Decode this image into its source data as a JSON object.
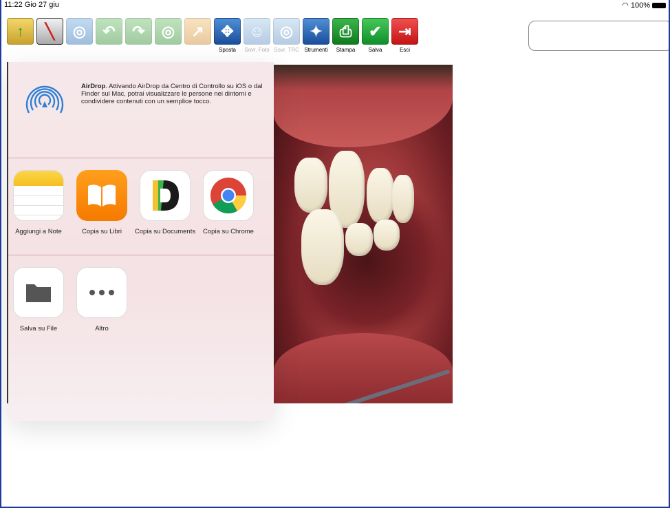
{
  "statusbar": {
    "time": "11:22  Gio 27 giu",
    "battery": "100%",
    "wifi_icon": "wifi-icon"
  },
  "toolbar": {
    "tools": [
      {
        "name": "open-folder",
        "label": "",
        "icon": "folder-icon",
        "enabled": true
      },
      {
        "name": "ruler",
        "label": "",
        "icon": "ruler-icon",
        "enabled": true
      },
      {
        "name": "tool-1",
        "label": "",
        "icon": "target-icon",
        "enabled": false
      },
      {
        "name": "undo",
        "label": "",
        "icon": "undo-icon",
        "enabled": false
      },
      {
        "name": "redo",
        "label": "",
        "icon": "redo-icon",
        "enabled": false
      },
      {
        "name": "tool-2",
        "label": "",
        "icon": "target-icon",
        "enabled": false
      },
      {
        "name": "tool-3",
        "label": "",
        "icon": "cursor-target-icon",
        "enabled": false
      },
      {
        "name": "sposta",
        "label": "Sposta",
        "icon": "move-icon",
        "enabled": true
      },
      {
        "name": "sovr-foto",
        "label": "Sovr. Foto",
        "icon": "person-icon",
        "enabled": false
      },
      {
        "name": "sovr-trc",
        "label": "Sovr. TRC",
        "icon": "target-icon",
        "enabled": false
      },
      {
        "name": "strumenti",
        "label": "Strumenti",
        "icon": "magic-wand-icon",
        "enabled": true
      },
      {
        "name": "stampa",
        "label": "Stampa",
        "icon": "printer-icon",
        "enabled": true
      },
      {
        "name": "salva",
        "label": "Salva",
        "icon": "check-icon",
        "enabled": true
      },
      {
        "name": "esci",
        "label": "Esci",
        "icon": "exit-icon",
        "enabled": true
      }
    ]
  },
  "share": {
    "airdrop": {
      "title": "AirDrop",
      "text": ". Attivando AirDrop da Centro di Controllo su iOS o dal Finder sul Mac, potrai visualizzare le persone nei dintorni e condividere contenuti con un semplice tocco."
    },
    "apps": [
      {
        "label": "Aggiungi a Note"
      },
      {
        "label": "Copia su Libri"
      },
      {
        "label": "Copia su Documents"
      },
      {
        "label": "Copia su Chrome"
      }
    ],
    "actions": [
      {
        "label": "Salva su File"
      },
      {
        "label": "Altro"
      }
    ]
  },
  "colors": {
    "frame": "#1e3a9a",
    "exit": "#c41414",
    "save": "#108f2a"
  }
}
